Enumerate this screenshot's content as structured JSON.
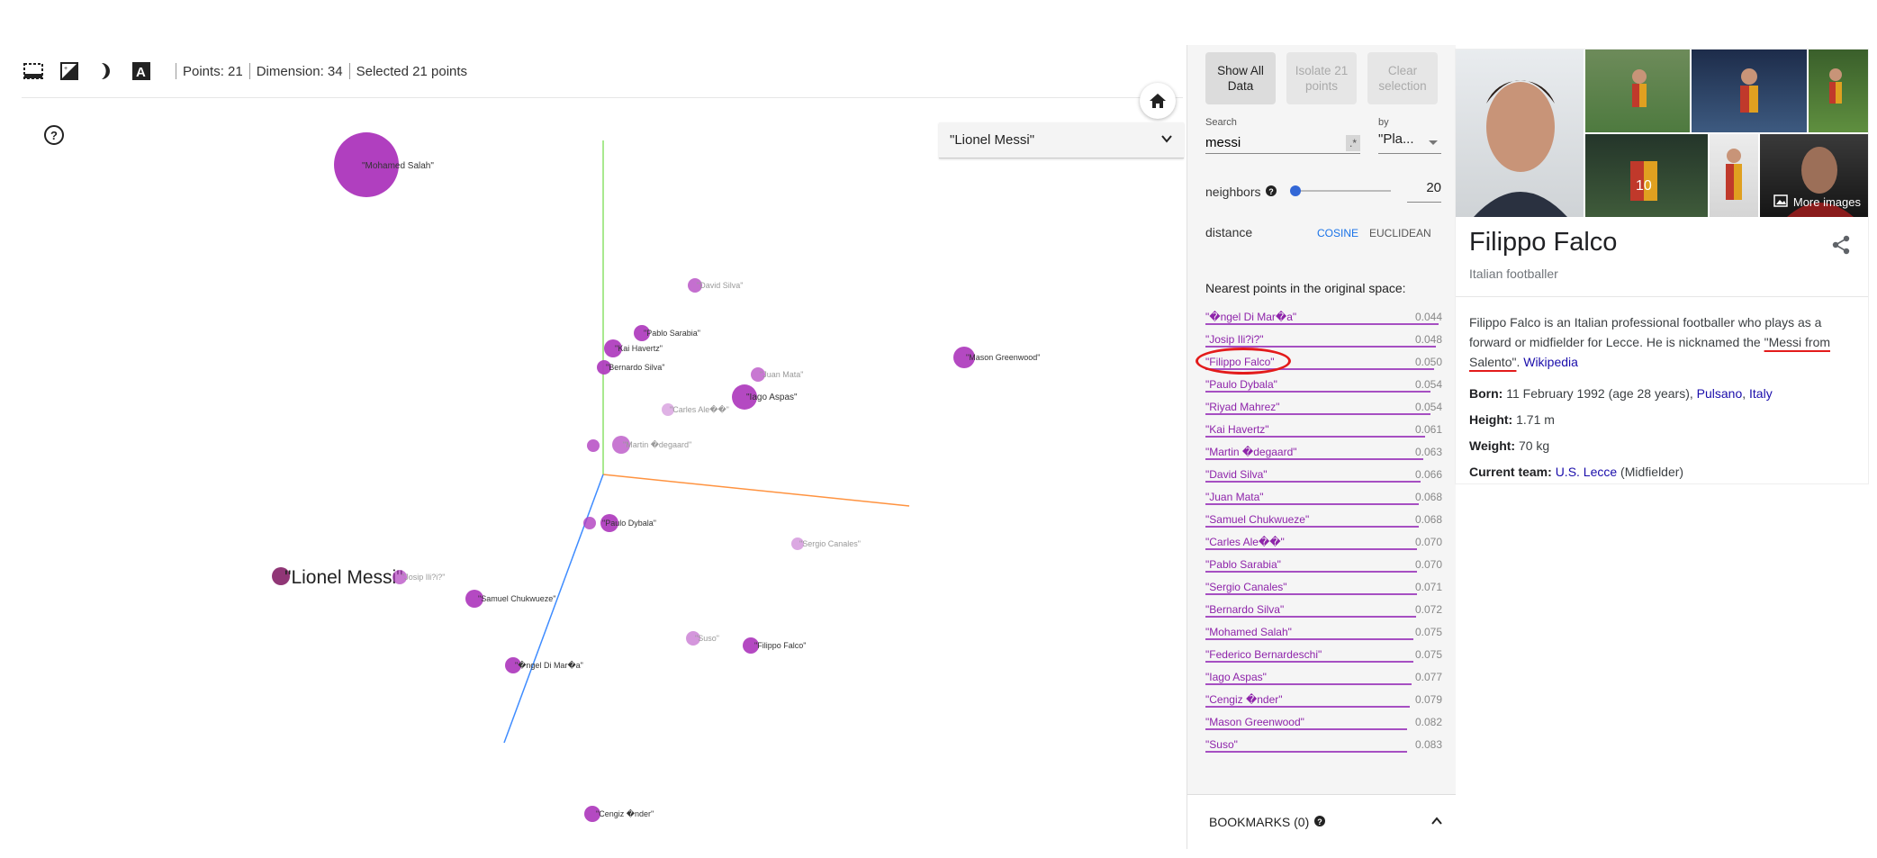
{
  "toolbar": {
    "points_text": "Points: 21",
    "dimension_text": "Dimension: 34",
    "selected_text": "Selected 21 points"
  },
  "label_selector": {
    "value": "\"Lionel Messi\""
  },
  "scene_points": [
    {
      "label": "\"Mohamed Salah\"",
      "big": true
    },
    {
      "label": "\"David Silva\""
    },
    {
      "label": "\"Pablo Sarabia\""
    },
    {
      "label": "\"Kai Havertz\""
    },
    {
      "label": "\"Bernardo Silva\""
    },
    {
      "label": "\"Juan Mata\""
    },
    {
      "label": "\"Iago Aspas\""
    },
    {
      "label": "\"Carles Ale��\""
    },
    {
      "label": "\"Martin �degaard\""
    },
    {
      "label": "\"Mason Greenwood\""
    },
    {
      "label": "\"Paulo Dybala\""
    },
    {
      "label": "\"Sergio Canales\""
    },
    {
      "label": "\"Lionel Messi\""
    },
    {
      "label": "\"Josip Ili?i?\""
    },
    {
      "label": "\"Samuel Chukwueze\""
    },
    {
      "label": "\"Suso\""
    },
    {
      "label": "\"Filippo Falco\""
    },
    {
      "label": "\"�ngel Di Mar�a\""
    },
    {
      "label": "\"Cengiz �nder\""
    }
  ],
  "panel": {
    "show_all": "Show All Data",
    "isolate": "Isolate 21 points",
    "clear": "Clear selection",
    "search_label": "Search",
    "search_value": "messi",
    "regex": ".*",
    "by_label": "by",
    "by_value": "\"Pla...",
    "neighbors_label": "neighbors",
    "neighbors_value": "20",
    "distance_label": "distance",
    "cosine": "COSINE",
    "euclidean": "EUCLIDEAN",
    "nn_title": "Nearest points in the original space:",
    "bookmarks": "BOOKMARKS (0)"
  },
  "neighbors": [
    {
      "name": "\"�ngel Di Mar�a\"",
      "value": "0.044"
    },
    {
      "name": "\"Josip Ili?i?\"",
      "value": "0.048"
    },
    {
      "name": "\"Filippo Falco\"",
      "value": "0.050"
    },
    {
      "name": "\"Paulo Dybala\"",
      "value": "0.054"
    },
    {
      "name": "\"Riyad Mahrez\"",
      "value": "0.054"
    },
    {
      "name": "\"Kai Havertz\"",
      "value": "0.061"
    },
    {
      "name": "\"Martin �degaard\"",
      "value": "0.063"
    },
    {
      "name": "\"David Silva\"",
      "value": "0.066"
    },
    {
      "name": "\"Juan Mata\"",
      "value": "0.068"
    },
    {
      "name": "\"Samuel Chukwueze\"",
      "value": "0.068"
    },
    {
      "name": "\"Carles Ale��\"",
      "value": "0.070"
    },
    {
      "name": "\"Pablo Sarabia\"",
      "value": "0.070"
    },
    {
      "name": "\"Sergio Canales\"",
      "value": "0.071"
    },
    {
      "name": "\"Bernardo Silva\"",
      "value": "0.072"
    },
    {
      "name": "\"Mohamed Salah\"",
      "value": "0.075"
    },
    {
      "name": "\"Federico Bernardeschi\"",
      "value": "0.075"
    },
    {
      "name": "\"Iago Aspas\"",
      "value": "0.077"
    },
    {
      "name": "\"Cengiz �nder\"",
      "value": "0.079"
    },
    {
      "name": "\"Mason Greenwood\"",
      "value": "0.082"
    },
    {
      "name": "\"Suso\"",
      "value": "0.083"
    }
  ],
  "knowledge_card": {
    "more_images": "More images",
    "name": "Filippo Falco",
    "subtitle": "Italian footballer",
    "desc_1": "Filippo Falco is an Italian professional footballer who plays as a forward or midfielder for Lecce. He is nicknamed the ",
    "desc_highlight": "\"Messi from Salento\"",
    "desc_2": ". ",
    "desc_link": "Wikipedia",
    "born_label": "Born:",
    "born_text": " 11 February 1992 (age 28 years), ",
    "born_city": "Pulsano",
    "born_sep": ", ",
    "born_country": "Italy",
    "height_label": "Height:",
    "height_value": " 1.71 m",
    "weight_label": "Weight:",
    "weight_value": " 70 kg",
    "team_label": "Current team:",
    "team_link": "U.S. Lecce",
    "team_role": " (Midfielder)"
  },
  "colors": {
    "point": "#b03fbf",
    "point_dark": "#8a2b6f",
    "axis_x": "#ff9340",
    "axis_y": "#8be26a",
    "axis_z": "#3f8cff",
    "neighbor_text": "#8e24aa",
    "highlight_circle": "#e31b1b"
  }
}
